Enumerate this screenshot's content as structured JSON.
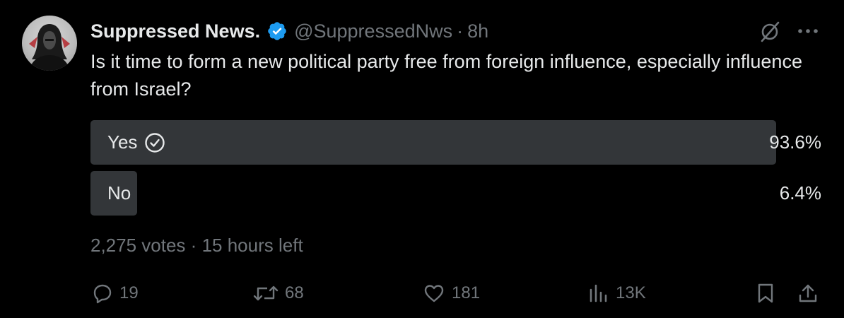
{
  "tweet": {
    "author_name": "Suppressed News.",
    "handle": "@SuppressedNws",
    "separator": "·",
    "time": "8h",
    "text": "Is it time to form a new political party free from foreign influence, especially influence from Israel?"
  },
  "poll": {
    "options": [
      {
        "label": "Yes",
        "percent_text": "93.6%",
        "percent": 93.6,
        "selected": true
      },
      {
        "label": "No",
        "percent_text": "6.4%",
        "percent": 6.4,
        "selected": false
      }
    ],
    "votes": "2,275 votes",
    "separator": "·",
    "time_left": "15 hours left"
  },
  "actions": {
    "replies": "19",
    "reposts": "68",
    "likes": "181",
    "views": "13K"
  },
  "colors": {
    "background": "#000000",
    "text": "#e7e9ea",
    "muted": "#71767b",
    "poll_fill": "#333639",
    "verified": "#1d9bf0"
  },
  "icons": [
    "verified-badge-icon",
    "grok-icon",
    "more-icon",
    "check-circle-icon",
    "reply-icon",
    "repost-icon",
    "like-icon",
    "views-icon",
    "bookmark-icon",
    "share-icon"
  ]
}
